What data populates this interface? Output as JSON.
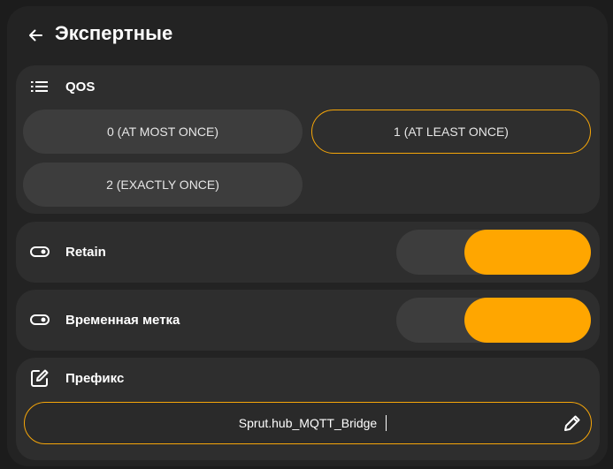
{
  "header": {
    "title": "Экспертные",
    "back_icon": "arrow-left-icon"
  },
  "qos": {
    "label": "QOS",
    "icon": "list-icon",
    "options": [
      {
        "label": "0 (AT MOST ONCE)",
        "selected": false
      },
      {
        "label": "1 (AT LEAST ONCE)",
        "selected": true
      },
      {
        "label": "2 (EXACTLY ONCE)",
        "selected": false
      }
    ]
  },
  "retain": {
    "label": "Retain",
    "icon": "toggle-icon",
    "enabled": true
  },
  "timestamp": {
    "label": "Временная метка",
    "icon": "toggle-icon",
    "enabled": true
  },
  "prefix": {
    "label": "Префикс",
    "icon": "edit-square-icon",
    "value": "Sprut.hub_MQTT_Bridge",
    "edit_icon": "pencil-icon"
  },
  "colors": {
    "accent": "#ffa600",
    "panel": "#232323",
    "card": "#2e2e2e",
    "button": "#3d3d3d"
  }
}
